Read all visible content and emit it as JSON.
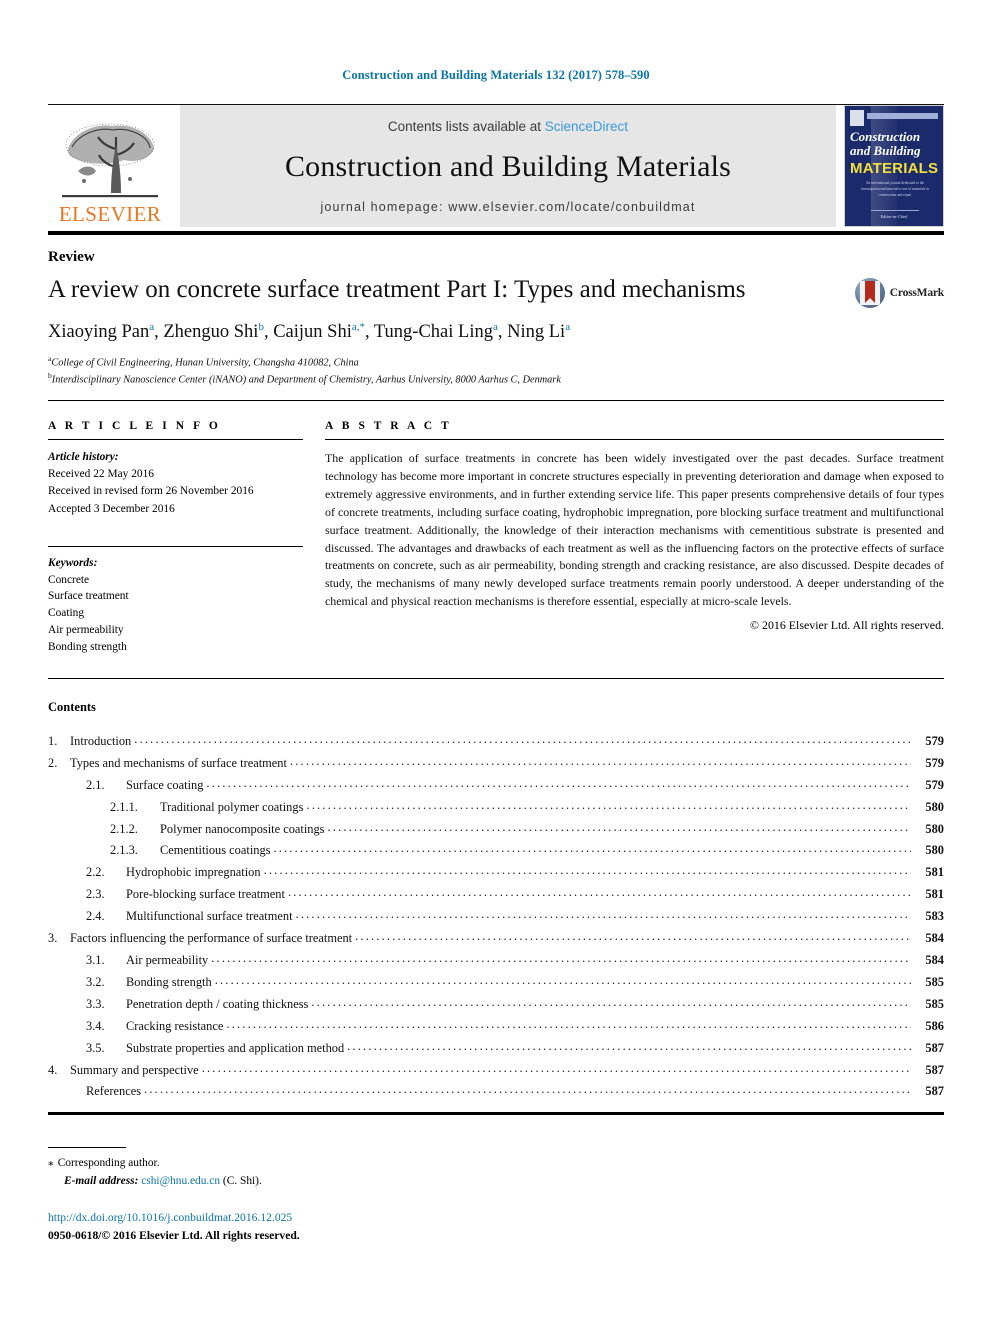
{
  "running_head": "Construction and Building Materials 132 (2017) 578–590",
  "masthead": {
    "publisher_logo_text": "ELSEVIER",
    "contents_prefix": "Contents lists available at",
    "contents_link": "ScienceDirect",
    "journal_title": "Construction and Building Materials",
    "homepage": "journal homepage: www.elsevier.com/locate/conbuildmat",
    "cover": {
      "line1": "Construction",
      "line2": "and Building",
      "line3": "MATERIALS",
      "blurb": "An international journal dedicated to the investigation and innovative use of materials in construction and repair",
      "foot": "Editor-in-Chief"
    }
  },
  "article": {
    "doctype": "Review",
    "title": "A review on concrete surface treatment Part I: Types and mechanisms",
    "crossmark_label": "CrossMark",
    "authors": [
      {
        "name": "Xiaoying Pan",
        "sup": "a"
      },
      {
        "name": "Zhenguo Shi",
        "sup": "b"
      },
      {
        "name": "Caijun Shi",
        "sup": "a,*"
      },
      {
        "name": "Tung-Chai Ling",
        "sup": "a"
      },
      {
        "name": "Ning Li",
        "sup": "a"
      }
    ],
    "affiliations": [
      {
        "sup": "a",
        "text": "College of Civil Engineering, Hunan University, Changsha 410082, China"
      },
      {
        "sup": "b",
        "text": "Interdisciplinary Nanoscience Center (iNANO) and Department of Chemistry, Aarhus University, 8000 Aarhus C, Denmark"
      }
    ]
  },
  "article_info": {
    "heading": "A R T I C L E   I N F O",
    "history_label": "Article history:",
    "history": [
      "Received 22 May 2016",
      "Received in revised form 26 November 2016",
      "Accepted 3 December 2016"
    ],
    "keywords_label": "Keywords:",
    "keywords": [
      "Concrete",
      "Surface treatment",
      "Coating",
      "Air permeability",
      "Bonding strength"
    ]
  },
  "abstract": {
    "heading": "A B S T R A C T",
    "text": "The application of surface treatments in concrete has been widely investigated over the past decades. Surface treatment technology has become more important in concrete structures especially in preventing deterioration and damage when exposed to extremely aggressive environments, and in further extending service life. This paper presents comprehensive details of four types of concrete treatments, including surface coating, hydrophobic impregnation, pore blocking surface treatment and multifunctional surface treatment. Additionally, the knowledge of their interaction mechanisms with cementitious substrate is presented and discussed. The advantages and drawbacks of each treatment as well as the influencing factors on the protective effects of surface treatments on concrete, such as air permeability, bonding strength and cracking resistance, are also discussed. Despite decades of study, the mechanisms of many newly developed surface treatments remain poorly understood. A deeper understanding of the chemical and physical reaction mechanisms is therefore essential, especially at micro-scale levels.",
    "copyright": "© 2016 Elsevier Ltd. All rights reserved."
  },
  "contents": {
    "heading": "Contents",
    "items": [
      {
        "level": 1,
        "num": "1.",
        "label": "Introduction",
        "page": "579"
      },
      {
        "level": 1,
        "num": "2.",
        "label": "Types and mechanisms of surface treatment",
        "page": "579"
      },
      {
        "level": 2,
        "num": "2.1.",
        "label": "Surface coating",
        "page": "579"
      },
      {
        "level": 3,
        "num": "2.1.1.",
        "label": "Traditional polymer coatings",
        "page": "580"
      },
      {
        "level": 3,
        "num": "2.1.2.",
        "label": "Polymer nanocomposite coatings",
        "page": "580"
      },
      {
        "level": 3,
        "num": "2.1.3.",
        "label": "Cementitious coatings",
        "page": "580"
      },
      {
        "level": 2,
        "num": "2.2.",
        "label": "Hydrophobic impregnation",
        "page": "581"
      },
      {
        "level": 2,
        "num": "2.3.",
        "label": "Pore-blocking surface treatment",
        "page": "581"
      },
      {
        "level": 2,
        "num": "2.4.",
        "label": "Multifunctional surface treatment",
        "page": "583"
      },
      {
        "level": 1,
        "num": "3.",
        "label": "Factors influencing the performance of surface treatment",
        "page": "584"
      },
      {
        "level": 2,
        "num": "3.1.",
        "label": "Air permeability",
        "page": "584"
      },
      {
        "level": 2,
        "num": "3.2.",
        "label": "Bonding strength",
        "page": "585"
      },
      {
        "level": 2,
        "num": "3.3.",
        "label": "Penetration depth / coating thickness",
        "page": "585"
      },
      {
        "level": 2,
        "num": "3.4.",
        "label": "Cracking resistance",
        "page": "586"
      },
      {
        "level": 2,
        "num": "3.5.",
        "label": "Substrate properties and application method",
        "page": "587"
      },
      {
        "level": 1,
        "num": "4.",
        "label": "Summary and perspective",
        "page": "587"
      },
      {
        "level": 0,
        "num": "",
        "label": "References",
        "page": "587"
      }
    ]
  },
  "footer": {
    "corresponding": "Corresponding author.",
    "email_label": "E-mail address:",
    "email": "cshi@hnu.edu.cn",
    "email_suffix": "(C. Shi).",
    "doi": "http://dx.doi.org/10.1016/j.conbuildmat.2016.12.025",
    "issn_line": "0950-0618/© 2016 Elsevier Ltd. All rights reserved."
  },
  "colors": {
    "link": "#0b74a8",
    "sciencedirect": "#3b9ad6",
    "elsevier_orange": "#e87722",
    "band_gray": "#e6e6e6",
    "cover_navy": "#1b2a6b"
  }
}
